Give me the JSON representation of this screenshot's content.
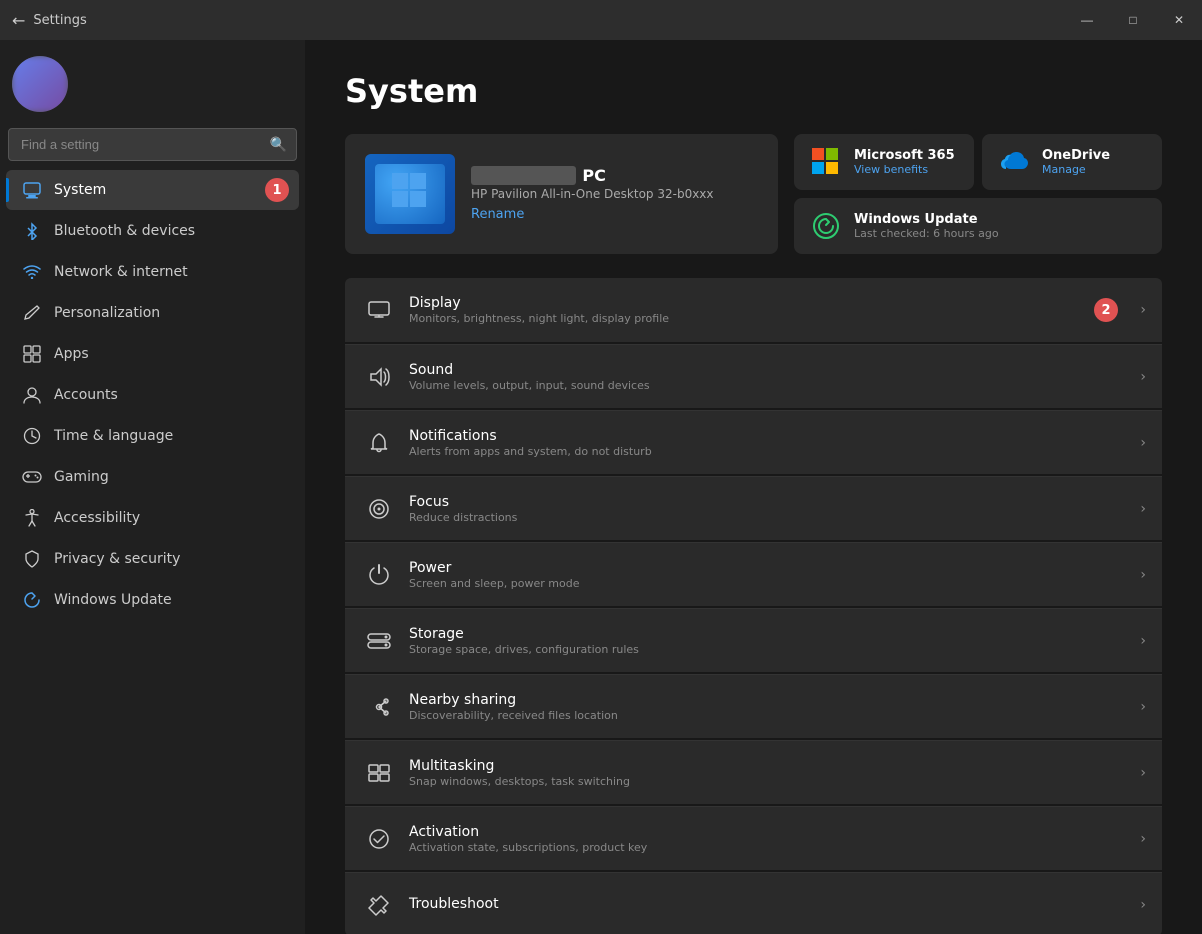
{
  "window": {
    "title": "Settings",
    "controls": {
      "minimize": "—",
      "maximize": "□",
      "close": "✕"
    }
  },
  "sidebar": {
    "search_placeholder": "Find a setting",
    "nav_items": [
      {
        "id": "system",
        "label": "System",
        "icon": "💻",
        "active": true,
        "annotation": "1"
      },
      {
        "id": "bluetooth",
        "label": "Bluetooth & devices",
        "icon": "🔵",
        "active": false
      },
      {
        "id": "network",
        "label": "Network & internet",
        "icon": "🌐",
        "active": false
      },
      {
        "id": "personalization",
        "label": "Personalization",
        "icon": "✏️",
        "active": false
      },
      {
        "id": "apps",
        "label": "Apps",
        "icon": "📱",
        "active": false
      },
      {
        "id": "accounts",
        "label": "Accounts",
        "icon": "👤",
        "active": false
      },
      {
        "id": "time",
        "label": "Time & language",
        "icon": "🕐",
        "active": false
      },
      {
        "id": "gaming",
        "label": "Gaming",
        "icon": "🎮",
        "active": false
      },
      {
        "id": "accessibility",
        "label": "Accessibility",
        "icon": "♿",
        "active": false
      },
      {
        "id": "privacy",
        "label": "Privacy & security",
        "icon": "🔒",
        "active": false
      },
      {
        "id": "winupdate",
        "label": "Windows Update",
        "icon": "🔄",
        "active": false
      }
    ]
  },
  "main": {
    "page_title": "System",
    "pc": {
      "name": "PC",
      "model": "HP Pavilion All-in-One Desktop 32-b0xxx",
      "rename_label": "Rename"
    },
    "services": [
      {
        "id": "ms365",
        "name": "Microsoft 365",
        "action": "View benefits",
        "color": "#e74c3c"
      },
      {
        "id": "onedrive",
        "name": "OneDrive",
        "action": "Manage",
        "color": "#2980b9"
      },
      {
        "id": "winupdate",
        "name": "Windows Update",
        "status": "Last checked: 6 hours ago",
        "color": "#2ecc71"
      }
    ],
    "settings_items": [
      {
        "id": "display",
        "label": "Display",
        "description": "Monitors, brightness, night light, display profile",
        "icon": "🖥️",
        "annotation": "2"
      },
      {
        "id": "sound",
        "label": "Sound",
        "description": "Volume levels, output, input, sound devices",
        "icon": "🔊"
      },
      {
        "id": "notifications",
        "label": "Notifications",
        "description": "Alerts from apps and system, do not disturb",
        "icon": "🔔"
      },
      {
        "id": "focus",
        "label": "Focus",
        "description": "Reduce distractions",
        "icon": "⏱️"
      },
      {
        "id": "power",
        "label": "Power",
        "description": "Screen and sleep, power mode",
        "icon": "⏻"
      },
      {
        "id": "storage",
        "label": "Storage",
        "description": "Storage space, drives, configuration rules",
        "icon": "💾"
      },
      {
        "id": "nearby",
        "label": "Nearby sharing",
        "description": "Discoverability, received files location",
        "icon": "📡"
      },
      {
        "id": "multitasking",
        "label": "Multitasking",
        "description": "Snap windows, desktops, task switching",
        "icon": "⊞"
      },
      {
        "id": "activation",
        "label": "Activation",
        "description": "Activation state, subscriptions, product key",
        "icon": "✓"
      },
      {
        "id": "troubleshoot",
        "label": "Troubleshoot",
        "description": "",
        "icon": "🔧"
      }
    ]
  }
}
